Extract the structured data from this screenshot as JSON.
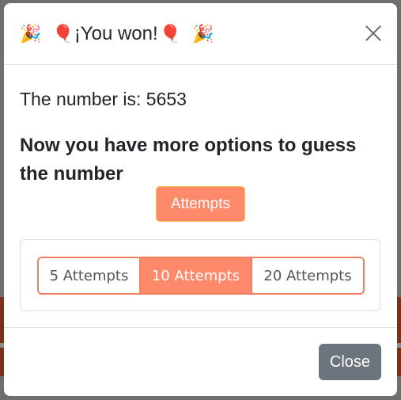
{
  "modal": {
    "title": {
      "left_party": "🎉",
      "left_balloon": "🎈",
      "text": "¡You won!",
      "right_balloon": "🎈",
      "right_party": "🎉"
    },
    "number_line": "The number is: 5653",
    "options_heading": "Now you have more options to guess the number",
    "attempts_button": "Attempts",
    "attempt_options": [
      {
        "label": "5 Attempts",
        "selected": false
      },
      {
        "label": "10 Attempts",
        "selected": true
      },
      {
        "label": "20 Attempts",
        "selected": false
      }
    ],
    "close_button": "Close"
  },
  "colors": {
    "accent": "#ff8a6b",
    "accent_border": "#f08060",
    "secondary": "#6c757d"
  },
  "icons": {
    "close": "close-icon",
    "party": "party-popper-icon",
    "balloon": "balloon-icon"
  }
}
